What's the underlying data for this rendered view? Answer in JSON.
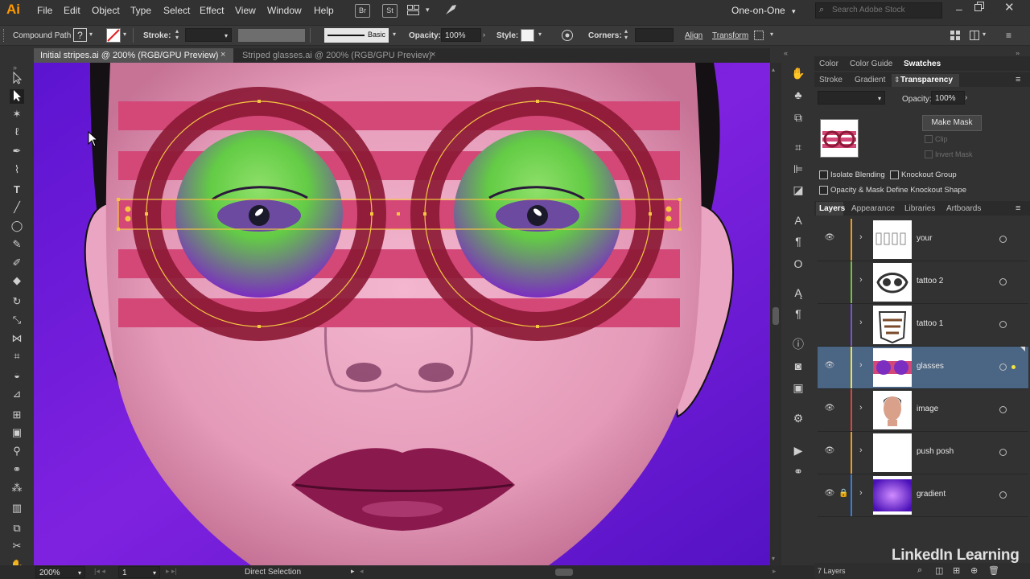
{
  "app": {
    "logo": "Ai"
  },
  "menu": [
    "File",
    "Edit",
    "Object",
    "Type",
    "Select",
    "Effect",
    "View",
    "Window",
    "Help"
  ],
  "menubar_icons": {
    "bridge": "Br",
    "stock": "St"
  },
  "workspace": "One-on-One",
  "stock_search_placeholder": "Search Adobe Stock",
  "control": {
    "object_type": "Compound Path",
    "stroke_label": "Stroke:",
    "brush": "Basic",
    "opacity_label": "Opacity:",
    "opacity_value": "100%",
    "style_label": "Style:",
    "corners_label": "Corners:",
    "align": "Align",
    "transform": "Transform"
  },
  "tabs": [
    {
      "label": "Initial stripes.ai @ 200% (RGB/GPU Preview)"
    },
    {
      "label": "Striped glasses.ai @ 200% (RGB/GPU Preview)"
    }
  ],
  "status": {
    "zoom": "200%",
    "artboard": "1",
    "tool": "Direct Selection"
  },
  "panels": {
    "top_tabs": [
      "Color",
      "Color Guide",
      "Swatches"
    ],
    "mid_tabs": [
      "Stroke",
      "Gradient",
      "Transparency"
    ],
    "transparency": {
      "opacity_label": "Opacity:",
      "opacity_value": "100%",
      "make_mask": "Make Mask",
      "clip": "Clip",
      "invert_mask": "Invert Mask",
      "isolate_blending": "Isolate Blending",
      "knockout_group": "Knockout Group",
      "opacity_mask": "Opacity & Mask Define Knockout Shape"
    },
    "layer_tabs": [
      "Layers",
      "Appearance",
      "Libraries",
      "Artboards"
    ],
    "layers": [
      {
        "name": "your",
        "color": "#f29a1f"
      },
      {
        "name": "tattoo 2",
        "color": "#76c043"
      },
      {
        "name": "tattoo 1",
        "color": "#7b4fd6"
      },
      {
        "name": "glasses",
        "color": "#f4e23c"
      },
      {
        "name": "image",
        "color": "#e0443c"
      },
      {
        "name": "push posh",
        "color": "#f29a1f"
      },
      {
        "name": "gradient",
        "color": "#3a7be0"
      }
    ],
    "layer_count": "7 Layers"
  },
  "watermark": "LinkedIn Learning"
}
